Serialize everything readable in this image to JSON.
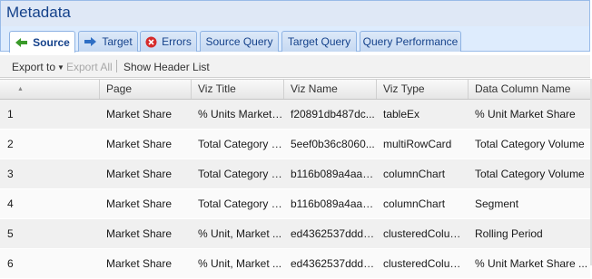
{
  "panel": {
    "title": "Metadata"
  },
  "tabs": [
    {
      "label": "Source",
      "icon": "back-arrow-icon",
      "active": true
    },
    {
      "label": "Target",
      "icon": "forward-arrow-icon",
      "active": false
    },
    {
      "label": "Errors",
      "icon": "error-circle-icon",
      "active": false
    },
    {
      "label": "Source Query",
      "icon": "",
      "active": false
    },
    {
      "label": "Target Query",
      "icon": "",
      "active": false
    },
    {
      "label": "Query Performance",
      "icon": "",
      "active": false
    }
  ],
  "toolbar": {
    "export_to": "Export to",
    "export_all": "Export All",
    "show_header_list": "Show Header List"
  },
  "grid": {
    "columns": [
      "",
      "Page",
      "Viz Title",
      "Viz Name",
      "Viz Type",
      "Data Column Name"
    ],
    "rows": [
      [
        "1",
        "Market Share",
        "% Units Market ...",
        "f20891db487dc...",
        "tableEx",
        "% Unit Market Share"
      ],
      [
        "2",
        "Market Share",
        "Total Category V...",
        "5eef0b36c8060...",
        "multiRowCard",
        "Total Category Volume"
      ],
      [
        "3",
        "Market Share",
        "Total Category V...",
        "b116b089a4aa5...",
        "columnChart",
        "Total Category Volume"
      ],
      [
        "4",
        "Market Share",
        "Total Category V...",
        "b116b089a4aa5...",
        "columnChart",
        "Segment"
      ],
      [
        "5",
        "Market Share",
        "% Unit, Market ...",
        "ed4362537ddd0...",
        "clusteredColum...",
        "Rolling Period"
      ],
      [
        "6",
        "Market Share",
        "% Unit, Market ...",
        "ed4362537ddd0...",
        "clusteredColum...",
        "% Unit Market Share ..."
      ]
    ]
  },
  "colors": {
    "title_bg": "#dfe8f6",
    "title_text": "#15428b",
    "tab_border": "#8db2e3"
  }
}
